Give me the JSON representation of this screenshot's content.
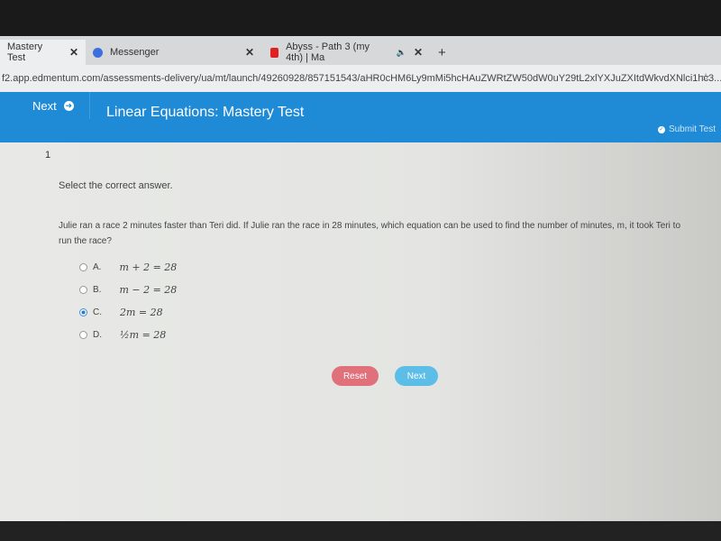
{
  "browser": {
    "tabs": [
      {
        "label": "Mastery Test",
        "active": true,
        "close": "✕"
      },
      {
        "label": "Messenger",
        "icon": "messenger-icon",
        "close": "✕"
      },
      {
        "label": "Abyss - Path 3 (my 4th) | Ma",
        "icon": "youtube-icon",
        "audio": "🔈",
        "close": "✕"
      }
    ],
    "new_tab": "+",
    "url": "f2.app.edmentum.com/assessments-delivery/ua/mt/launch/49260928/857151543/aHR0cHM6Ly9mMi5hcHAuZWRtZW50dW0uY29tL2xlYXJuZXItdWkvdXNlci1hc3..."
  },
  "header": {
    "next_label": "Next",
    "title": "Linear Equations: Mastery Test",
    "submit_label": "Submit Test",
    "accent": "#1f8ad6"
  },
  "question": {
    "number": "1",
    "instruction": "Select the correct answer.",
    "text": "Julie ran a race 2 minutes faster than Teri did. If Julie ran the race in 28 minutes, which equation can be used to find the number of minutes, m, it took Teri to run the race?",
    "options": [
      {
        "letter": "A.",
        "equation": "m + 2 = 28",
        "selected": false
      },
      {
        "letter": "B.",
        "equation": "m − 2 = 28",
        "selected": false
      },
      {
        "letter": "C.",
        "equation": "2m = 28",
        "selected": true
      },
      {
        "letter": "D.",
        "equation": "½m = 28",
        "selected": false
      }
    ]
  },
  "actions": {
    "reset_label": "Reset",
    "next_label": "Next",
    "reset_color": "#e0707a",
    "next_color": "#5cbde6"
  }
}
